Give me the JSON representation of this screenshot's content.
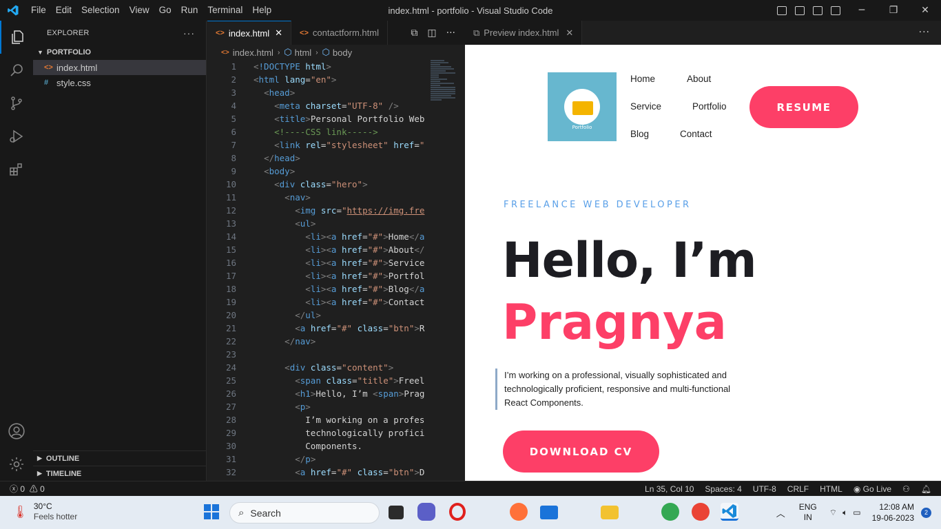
{
  "window": {
    "title": "index.html - portfolio - Visual Studio Code",
    "menu": [
      "File",
      "Edit",
      "Selection",
      "View",
      "Go",
      "Run",
      "Terminal",
      "Help"
    ]
  },
  "explorer": {
    "header": "EXPLORER",
    "folder": "PORTFOLIO",
    "files": [
      {
        "icon": "<>",
        "name": "index.html"
      },
      {
        "icon": "#",
        "name": "style.css"
      }
    ],
    "outline": "OUTLINE",
    "timeline": "TIMELINE"
  },
  "editor": {
    "tabs": [
      {
        "name": "index.html",
        "active": true
      },
      {
        "name": "contactform.html",
        "active": false
      }
    ],
    "breadcrumb": [
      "index.html",
      "html",
      "body"
    ],
    "lines": [
      {
        "n": "1",
        "html": "<span class=\"p\">&lt;</span><span class=\"t\">!DOCTYPE</span> <span class=\"a\">html</span><span class=\"p\">&gt;</span>"
      },
      {
        "n": "2",
        "html": "<span class=\"p\">&lt;</span><span class=\"t\">html</span> <span class=\"a\">lang</span><span class=\"w\">=</span><span class=\"s\">\"en\"</span><span class=\"p\">&gt;</span>"
      },
      {
        "n": "3",
        "html": "  <span class=\"p\">&lt;</span><span class=\"t\">head</span><span class=\"p\">&gt;</span>"
      },
      {
        "n": "4",
        "html": "    <span class=\"p\">&lt;</span><span class=\"t\">meta</span> <span class=\"a\">charset</span><span class=\"w\">=</span><span class=\"s\">\"UTF-8\"</span> <span class=\"p\">/&gt;</span>"
      },
      {
        "n": "5",
        "html": "    <span class=\"p\">&lt;</span><span class=\"t\">title</span><span class=\"p\">&gt;</span><span class=\"w\">Personal Portfolio Web</span>"
      },
      {
        "n": "6",
        "html": "    <span class=\"c\">&lt;!----CSS link-----&gt;</span>"
      },
      {
        "n": "7",
        "html": "    <span class=\"p\">&lt;</span><span class=\"t\">link</span> <span class=\"a\">rel</span><span class=\"w\">=</span><span class=\"s\">\"stylesheet\"</span> <span class=\"a\">href</span><span class=\"w\">=</span><span class=\"s\">\"</span>"
      },
      {
        "n": "8",
        "html": "  <span class=\"p\">&lt;/</span><span class=\"t\">head</span><span class=\"p\">&gt;</span>"
      },
      {
        "n": "9",
        "html": "  <span class=\"p\">&lt;</span><span class=\"t\">body</span><span class=\"p\">&gt;</span>"
      },
      {
        "n": "10",
        "html": "    <span class=\"p\">&lt;</span><span class=\"t\">div</span> <span class=\"a\">class</span><span class=\"w\">=</span><span class=\"s\">\"hero\"</span><span class=\"p\">&gt;</span>"
      },
      {
        "n": "11",
        "html": "      <span class=\"p\">&lt;</span><span class=\"t\">nav</span><span class=\"p\">&gt;</span>"
      },
      {
        "n": "12",
        "html": "        <span class=\"p\">&lt;</span><span class=\"t\">img</span> <span class=\"a\">src</span><span class=\"w\">=</span><span class=\"s\">\"</span><span class=\"u\">https://img.fre</span>"
      },
      {
        "n": "13",
        "html": "        <span class=\"p\">&lt;</span><span class=\"t\">ul</span><span class=\"p\">&gt;</span>"
      },
      {
        "n": "14",
        "html": "          <span class=\"p\">&lt;</span><span class=\"t\">li</span><span class=\"p\">&gt;&lt;</span><span class=\"t\">a</span> <span class=\"a\">href</span><span class=\"w\">=</span><span class=\"s\">\"#\"</span><span class=\"p\">&gt;</span><span class=\"w\">Home</span><span class=\"p\">&lt;/</span><span class=\"t\">a</span>"
      },
      {
        "n": "15",
        "html": "          <span class=\"p\">&lt;</span><span class=\"t\">li</span><span class=\"p\">&gt;&lt;</span><span class=\"t\">a</span> <span class=\"a\">href</span><span class=\"w\">=</span><span class=\"s\">\"#\"</span><span class=\"p\">&gt;</span><span class=\"w\">About</span><span class=\"p\">&lt;/</span>"
      },
      {
        "n": "16",
        "html": "          <span class=\"p\">&lt;</span><span class=\"t\">li</span><span class=\"p\">&gt;&lt;</span><span class=\"t\">a</span> <span class=\"a\">href</span><span class=\"w\">=</span><span class=\"s\">\"#\"</span><span class=\"p\">&gt;</span><span class=\"w\">Service</span>"
      },
      {
        "n": "17",
        "html": "          <span class=\"p\">&lt;</span><span class=\"t\">li</span><span class=\"p\">&gt;&lt;</span><span class=\"t\">a</span> <span class=\"a\">href</span><span class=\"w\">=</span><span class=\"s\">\"#\"</span><span class=\"p\">&gt;</span><span class=\"w\">Portfol</span>"
      },
      {
        "n": "18",
        "html": "          <span class=\"p\">&lt;</span><span class=\"t\">li</span><span class=\"p\">&gt;&lt;</span><span class=\"t\">a</span> <span class=\"a\">href</span><span class=\"w\">=</span><span class=\"s\">\"#\"</span><span class=\"p\">&gt;</span><span class=\"w\">Blog</span><span class=\"p\">&lt;/</span><span class=\"t\">a</span>"
      },
      {
        "n": "19",
        "html": "          <span class=\"p\">&lt;</span><span class=\"t\">li</span><span class=\"p\">&gt;&lt;</span><span class=\"t\">a</span> <span class=\"a\">href</span><span class=\"w\">=</span><span class=\"s\">\"#\"</span><span class=\"p\">&gt;</span><span class=\"w\">Contact</span>"
      },
      {
        "n": "20",
        "html": "        <span class=\"p\">&lt;/</span><span class=\"t\">ul</span><span class=\"p\">&gt;</span>"
      },
      {
        "n": "21",
        "html": "        <span class=\"p\">&lt;</span><span class=\"t\">a</span> <span class=\"a\">href</span><span class=\"w\">=</span><span class=\"s\">\"#\"</span> <span class=\"a\">class</span><span class=\"w\">=</span><span class=\"s\">\"btn\"</span><span class=\"p\">&gt;</span><span class=\"w\">R</span>"
      },
      {
        "n": "22",
        "html": "      <span class=\"p\">&lt;/</span><span class=\"t\">nav</span><span class=\"p\">&gt;</span>"
      },
      {
        "n": "23",
        "html": ""
      },
      {
        "n": "24",
        "html": "      <span class=\"p\">&lt;</span><span class=\"t\">div</span> <span class=\"a\">class</span><span class=\"w\">=</span><span class=\"s\">\"content\"</span><span class=\"p\">&gt;</span>"
      },
      {
        "n": "25",
        "html": "        <span class=\"p\">&lt;</span><span class=\"t\">span</span> <span class=\"a\">class</span><span class=\"w\">=</span><span class=\"s\">\"title\"</span><span class=\"p\">&gt;</span><span class=\"w\">Freel</span>"
      },
      {
        "n": "26",
        "html": "        <span class=\"p\">&lt;</span><span class=\"t\">h1</span><span class=\"p\">&gt;</span><span class=\"w\">Hello, I’m </span><span class=\"p\">&lt;</span><span class=\"t\">span</span><span class=\"p\">&gt;</span><span class=\"w\">Prag</span>"
      },
      {
        "n": "27",
        "html": "        <span class=\"p\">&lt;</span><span class=\"t\">p</span><span class=\"p\">&gt;</span>"
      },
      {
        "n": "28",
        "html": "          <span class=\"w\">I’m working on a profes</span>"
      },
      {
        "n": "29",
        "html": "          <span class=\"w\">technologically profici</span>"
      },
      {
        "n": "30",
        "html": "          <span class=\"w\">Components.</span>"
      },
      {
        "n": "31",
        "html": "        <span class=\"p\">&lt;/</span><span class=\"t\">p</span><span class=\"p\">&gt;</span>"
      },
      {
        "n": "32",
        "html": "        <span class=\"p\">&lt;</span><span class=\"t\">a</span> <span class=\"a\">href</span><span class=\"w\">=</span><span class=\"s\">\"#\"</span> <span class=\"a\">class</span><span class=\"w\">=</span><span class=\"s\">\"btn\"</span><span class=\"p\">&gt;</span><span class=\"w\">D</span>"
      }
    ]
  },
  "preview": {
    "tab": "Preview index.html",
    "logo_text": "Portfolio",
    "nav": [
      "Home",
      "About",
      "Service",
      "Portfolio",
      "Blog",
      "Contact"
    ],
    "resume": "RESUME",
    "subtitle": "FREELANCE WEB DEVELOPER",
    "heading_line1": "Hello, I’m",
    "heading_line2": "Pragnya",
    "description": "I’m working on a professional, visually sophisticated and technologically proficient, responsive and multi-functional React Components.",
    "download": "DOWNLOAD CV"
  },
  "status": {
    "errors": "0",
    "warnings": "0",
    "position": "Ln 35, Col 10",
    "spaces": "Spaces: 4",
    "encoding": "UTF-8",
    "eol": "CRLF",
    "language": "HTML",
    "golive": "Go Live"
  },
  "taskbar": {
    "temp": "30°C",
    "weather": "Feels hotter",
    "search": "Search",
    "lang1": "ENG",
    "lang2": "IN",
    "time": "12:08 AM",
    "date": "19-06-2023",
    "notifications": "2"
  }
}
